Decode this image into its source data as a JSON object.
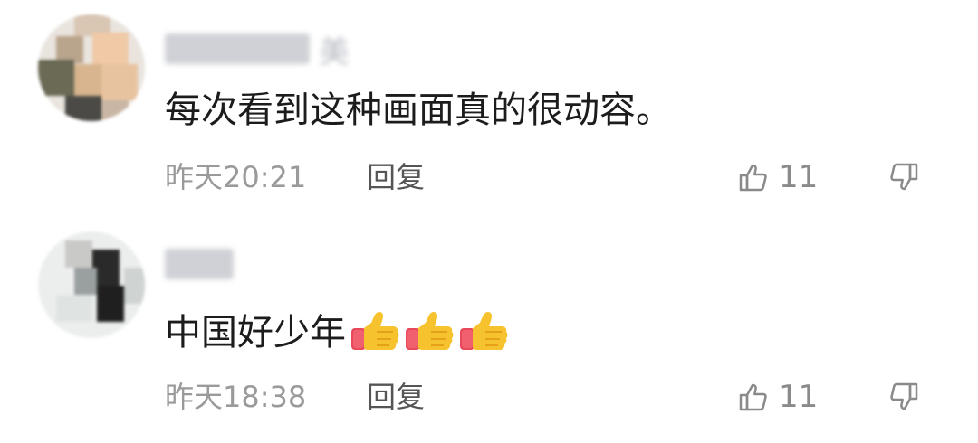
{
  "comments": [
    {
      "username_visible_char": "美",
      "text": "每次看到这种画面真的很动容。",
      "time": "昨天20:21",
      "reply_label": "回复",
      "like_count": "11",
      "emoji_count": 0
    },
    {
      "username_visible_char": "",
      "text": "中国好少年",
      "time": "昨天18:38",
      "reply_label": "回复",
      "like_count": "11",
      "emoji_count": 3
    }
  ],
  "icons": {
    "like": "thumbs-up-outline-icon",
    "dislike": "thumbs-down-outline-icon",
    "emoji": "thumbs-up-emoji"
  },
  "colors": {
    "meta_text": "#9a9a9a",
    "icon_stroke": "#8a8a8a",
    "emoji_yellow": "#f6c32e",
    "emoji_cuff": "#e9475a"
  }
}
